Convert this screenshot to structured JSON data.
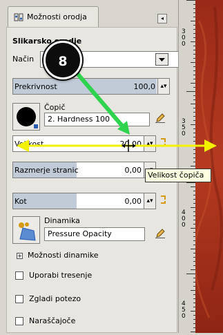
{
  "tab": {
    "label": "Možnosti orodja"
  },
  "section": {
    "title": "Slikarsko orodje"
  },
  "mode": {
    "label": "Način"
  },
  "opacity": {
    "label": "Prekrivnost",
    "value": "100,0",
    "fill": 1.0
  },
  "brush": {
    "label": "Čopič",
    "value": "2. Hardness 100"
  },
  "size": {
    "label": "Velikost",
    "value": "20,00"
  },
  "aspect": {
    "label": "Razmerje stranic",
    "value": "0,00"
  },
  "angle": {
    "label": "Kot",
    "value": "0,00"
  },
  "dynamics": {
    "label": "Dinamika",
    "value": "Pressure Opacity"
  },
  "dynamics_options": {
    "label": "Možnosti dinamike"
  },
  "checkboxes": [
    {
      "label": "Uporabi tresenje"
    },
    {
      "label": "Zgladi potezo"
    },
    {
      "label": "Naraščajoče"
    }
  ],
  "tooltip": {
    "text": "Velikost čopiča"
  },
  "annotation": {
    "number": "8"
  },
  "ruler": {
    "labels": [
      [
        "3",
        "0",
        "0"
      ],
      [
        "3",
        "5",
        "0"
      ],
      [
        "4",
        "0",
        "0"
      ],
      [
        "4",
        "5",
        "0"
      ]
    ]
  },
  "colors": {
    "arrow_green": "#2fd34e",
    "arrow_yellow": "#f2f200",
    "canvas": "#a52c1a",
    "slider_fill": "#c1cbd7"
  }
}
